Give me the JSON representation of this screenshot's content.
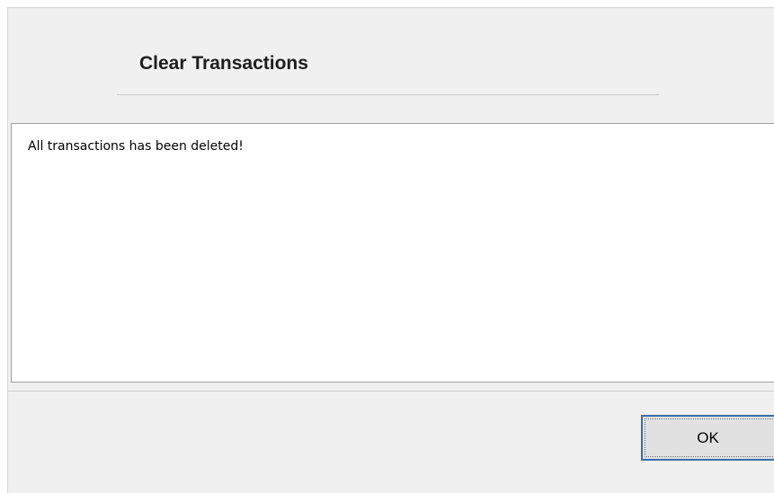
{
  "dialog": {
    "title": "Clear Transactions",
    "message": "All transactions has been deleted!",
    "ok_label": "OK"
  },
  "colors": {
    "background": "#f0f0f0",
    "button_focus_border": "#3c6db0"
  }
}
